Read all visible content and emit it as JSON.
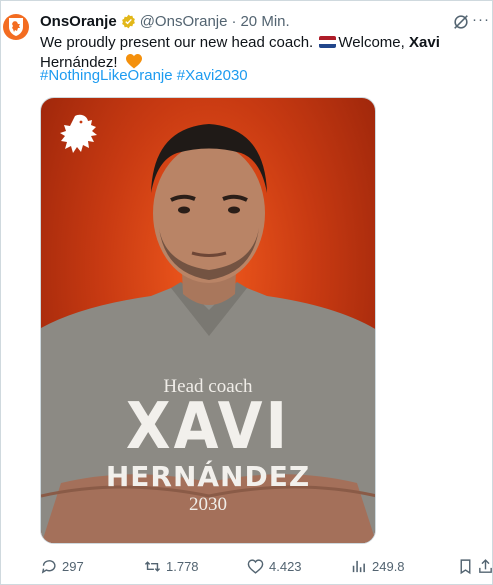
{
  "author": {
    "name": "OnsOranje",
    "handle": "@OnsOranje",
    "separator": "·",
    "time": "20 Min."
  },
  "tweet": {
    "text_part1": "We proudly present our new head coach.",
    "text_part2": "Welcome,",
    "text_bold": "Xavi",
    "text_part3": "Hernández!",
    "hashtags": "#NothingLikeOranje #Xavi2030"
  },
  "media": {
    "role": "Head coach",
    "first_name": "XAVI",
    "last_name": "HERNÁNDEZ",
    "year": "2030"
  },
  "actions": {
    "replies": "297",
    "retweets": "1.778",
    "likes": "4.423",
    "views": "249.8"
  },
  "colors": {
    "accent": "#1d9bf0",
    "brand_orange": "#f36c21",
    "muted": "#536471"
  },
  "icons": [
    "oranje-lion-icon",
    "verified-badge-icon",
    "grok-icon",
    "more-icon",
    "netherlands-flag-icon",
    "orange-heart-icon",
    "reply-icon",
    "retweet-icon",
    "like-icon",
    "views-icon",
    "bookmark-icon",
    "share-icon"
  ]
}
